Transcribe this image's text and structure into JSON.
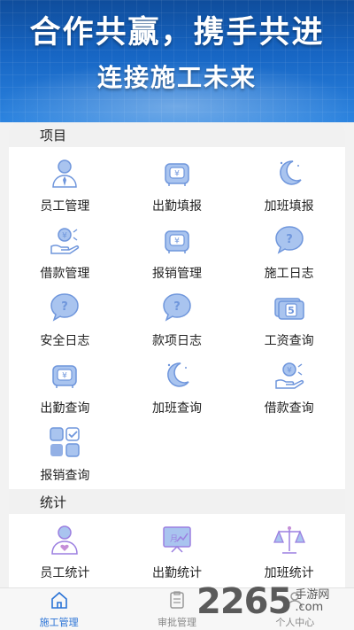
{
  "banner": {
    "title": "合作共赢，携手共进",
    "subtitle": "连接施工未来"
  },
  "sections": [
    {
      "title": "项目",
      "items": [
        {
          "label": "员工管理",
          "icon": "employee-icon"
        },
        {
          "label": "出勤填报",
          "icon": "attendance-icon"
        },
        {
          "label": "加班填报",
          "icon": "moon-icon"
        },
        {
          "label": "借款管理",
          "icon": "loan-icon"
        },
        {
          "label": "报销管理",
          "icon": "reimburse-icon"
        },
        {
          "label": "施工日志",
          "icon": "chat-question-icon"
        },
        {
          "label": "安全日志",
          "icon": "chat-question-icon"
        },
        {
          "label": "款项日志",
          "icon": "chat-question-icon"
        },
        {
          "label": "工资查询",
          "icon": "salary-icon"
        },
        {
          "label": "出勤查询",
          "icon": "attendance-icon"
        },
        {
          "label": "加班查询",
          "icon": "moon-icon"
        },
        {
          "label": "借款查询",
          "icon": "loan-icon"
        },
        {
          "label": "报销查询",
          "icon": "apps-icon"
        }
      ]
    },
    {
      "title": "统计",
      "items": [
        {
          "label": "员工统计",
          "icon": "employee-stats-icon"
        },
        {
          "label": "出勤统计",
          "icon": "chart-board-icon"
        },
        {
          "label": "加班统计",
          "icon": "scale-icon"
        }
      ]
    }
  ],
  "tabbar": [
    {
      "label": "施工管理",
      "icon": "home-icon",
      "active": true
    },
    {
      "label": "审批管理",
      "icon": "clipboard-icon",
      "active": false
    },
    {
      "label": "个人中心",
      "icon": "person-icon",
      "active": false
    }
  ],
  "watermark": {
    "main": "2265",
    "side1": "手游网",
    "side2": ".com"
  },
  "colors": {
    "icon_fill": "#a9c4ef",
    "icon_stroke": "#6f96dc",
    "active_tab": "#2a73d6"
  }
}
